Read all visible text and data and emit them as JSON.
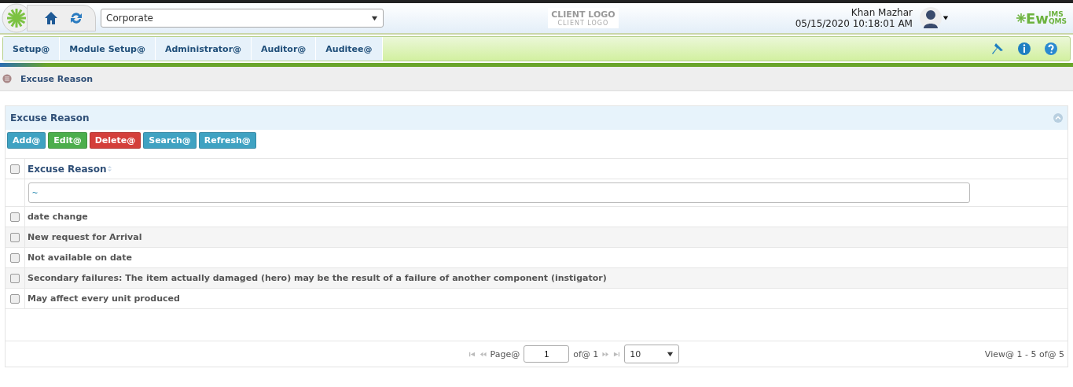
{
  "header": {
    "site_select": "Corporate",
    "client_logo": {
      "title": "CLIENT LOGO",
      "subtitle": "CLIENT LOGO"
    },
    "user": {
      "name": "Khan Mazhar",
      "datetime": "05/15/2020 10:18:01 AM"
    },
    "brand": {
      "main": "Ew",
      "top": "IMS",
      "bottom": "QMS"
    }
  },
  "menu": [
    {
      "label": "Setup@",
      "selected": false
    },
    {
      "label": "Module Setup@",
      "selected": false
    },
    {
      "label": "Administrator@",
      "selected": false
    },
    {
      "label": "Auditor@",
      "selected": false
    },
    {
      "label": "Auditee@",
      "selected": false
    }
  ],
  "breadcrumb": "Excuse Reason",
  "panel": {
    "title": "Excuse Reason",
    "buttons": [
      {
        "label": "Add@",
        "kind": "info"
      },
      {
        "label": "Edit@",
        "kind": "success"
      },
      {
        "label": "Delete@",
        "kind": "danger"
      },
      {
        "label": "Search@",
        "kind": "info"
      },
      {
        "label": "Refresh@",
        "kind": "info"
      }
    ],
    "table": {
      "header_checked": false,
      "column": "Excuse Reason",
      "filter": "~",
      "rows": [
        {
          "text": "date change",
          "checked": false
        },
        {
          "text": "New request for Arrival",
          "checked": false
        },
        {
          "text": "Not available on date",
          "checked": false
        },
        {
          "text": "Secondary failures: The item actually damaged (hero) may be the result of a failure of another component (instigator)",
          "checked": false
        },
        {
          "text": "May affect every unit produced",
          "checked": false
        }
      ]
    },
    "pager": {
      "page_label": "Page@",
      "page": "1",
      "of": "of@ 1",
      "page_size": "10",
      "view": "View@ 1 - 5 of@ 5"
    }
  }
}
